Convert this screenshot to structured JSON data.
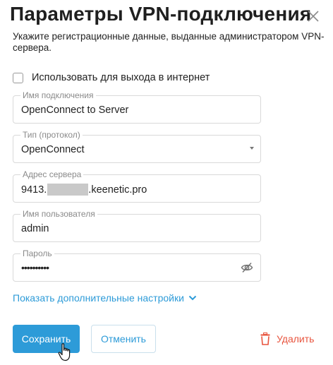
{
  "dialog": {
    "title": "Параметры VPN-подключения",
    "subtitle": "Укажите регистрационные данные, выданные администратором VPN-сервера."
  },
  "icons": {
    "close": "close-icon",
    "dropdown": "chevron-down-icon",
    "password_toggle": "eye-slash-icon",
    "more": "chevron-down-icon",
    "delete": "trash-icon",
    "pointer": "hand-pointer-cursor"
  },
  "checkbox": {
    "label": "Использовать для выхода в интернет",
    "checked": false
  },
  "fields": {
    "connection_name": {
      "label": "Имя подключения",
      "value": "OpenConnect to Server"
    },
    "protocol": {
      "label": "Тип (протокол)",
      "value": "OpenConnect"
    },
    "server": {
      "label": "Адрес сервера",
      "value_prefix": "9413.",
      "value_suffix": ".keenetic.pro"
    },
    "username": {
      "label": "Имя пользователя",
      "value": "admin"
    },
    "password": {
      "label": "Пароль",
      "value": "••••••••••"
    }
  },
  "more_settings": {
    "label": "Показать дополнительные настройки"
  },
  "buttons": {
    "save": "Сохранить",
    "cancel": "Отменить",
    "delete": "Удалить"
  },
  "colors": {
    "accent": "#2d9bd8",
    "danger": "#e8543e",
    "border": "#d9d9d9",
    "label": "#8a8a8a"
  }
}
